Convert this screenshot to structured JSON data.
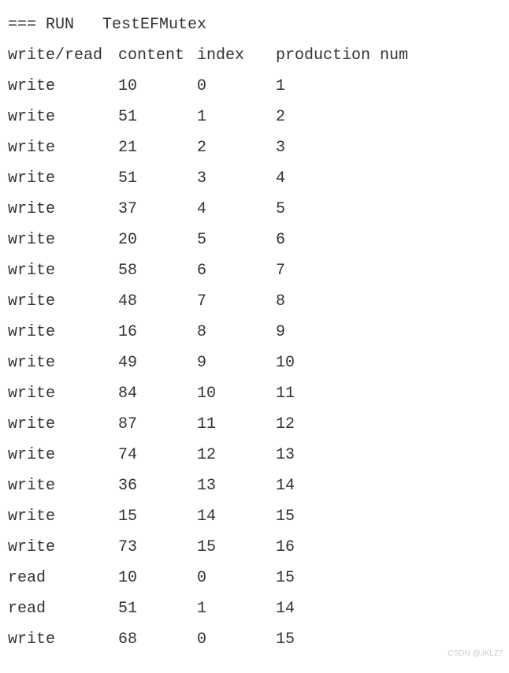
{
  "run_line": "=== RUN   TestEFMutex",
  "header": {
    "col1": "write/read",
    "col2": "content",
    "col3": "index",
    "col4": "production num"
  },
  "rows": [
    {
      "op": "write",
      "content": "10",
      "index": "0",
      "prod": "1"
    },
    {
      "op": "write",
      "content": "51",
      "index": "1",
      "prod": "2"
    },
    {
      "op": "write",
      "content": "21",
      "index": "2",
      "prod": "3"
    },
    {
      "op": "write",
      "content": "51",
      "index": "3",
      "prod": "4"
    },
    {
      "op": "write",
      "content": "37",
      "index": "4",
      "prod": "5"
    },
    {
      "op": "write",
      "content": "20",
      "index": "5",
      "prod": "6"
    },
    {
      "op": "write",
      "content": "58",
      "index": "6",
      "prod": "7"
    },
    {
      "op": "write",
      "content": "48",
      "index": "7",
      "prod": "8"
    },
    {
      "op": "write",
      "content": "16",
      "index": "8",
      "prod": "9"
    },
    {
      "op": "write",
      "content": "49",
      "index": "9",
      "prod": "10"
    },
    {
      "op": "write",
      "content": "84",
      "index": "10",
      "prod": "11"
    },
    {
      "op": "write",
      "content": "87",
      "index": "11",
      "prod": "12"
    },
    {
      "op": "write",
      "content": "74",
      "index": "12",
      "prod": "13"
    },
    {
      "op": "write",
      "content": "36",
      "index": "13",
      "prod": "14"
    },
    {
      "op": "write",
      "content": "15",
      "index": "14",
      "prod": "15"
    },
    {
      "op": "write",
      "content": "73",
      "index": "15",
      "prod": "16"
    },
    {
      "op": "read",
      "content": "10",
      "index": "0",
      "prod": "15"
    },
    {
      "op": "read",
      "content": "51",
      "index": "1",
      "prod": "14"
    },
    {
      "op": "write",
      "content": "68",
      "index": "0",
      "prod": "15"
    }
  ],
  "watermark": "CSDN @JKL27"
}
